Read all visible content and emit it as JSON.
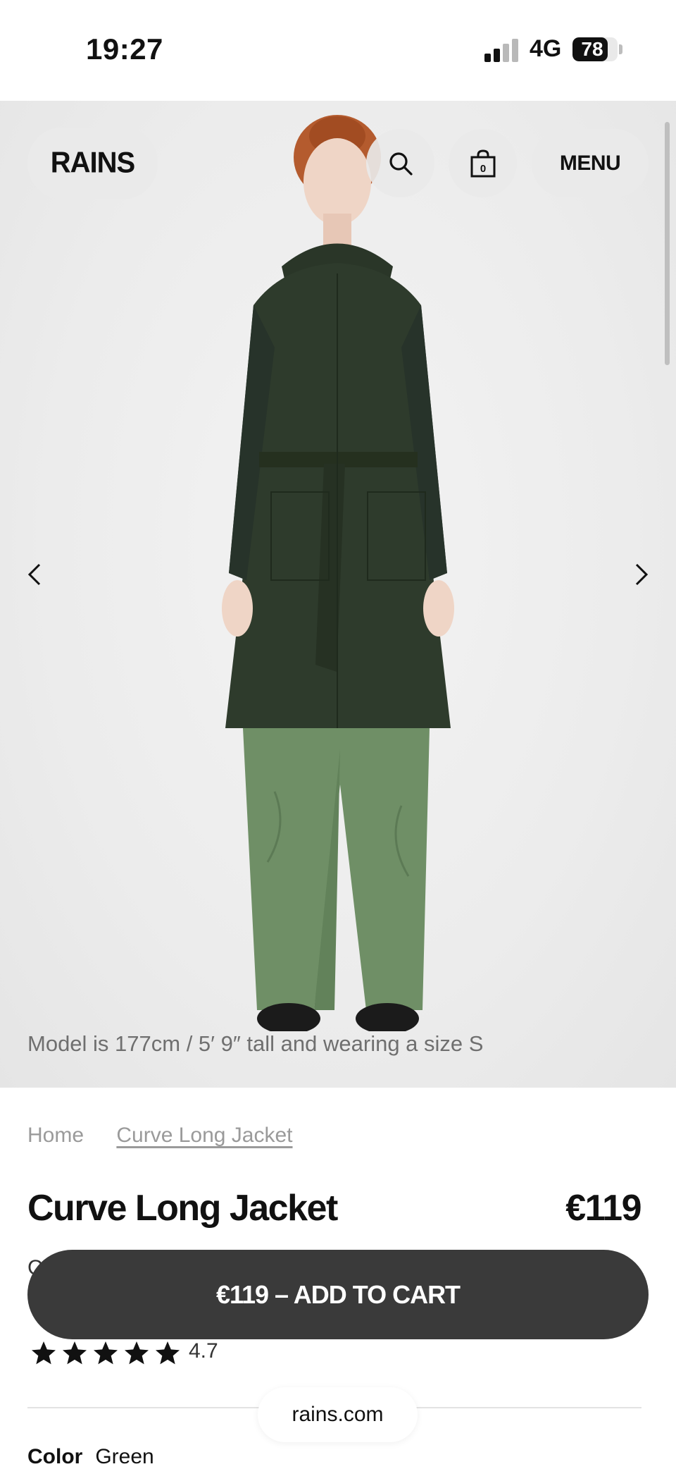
{
  "status_bar": {
    "time": "19:27",
    "network": "4G",
    "battery": "78",
    "battery_level": 0.78,
    "signal_bars": 2,
    "signal_total": 4
  },
  "header": {
    "logo": "RAINS",
    "menu_label": "MENU",
    "bag_count": "0",
    "search_icon": "search-icon",
    "bag_icon": "shopping-bag-icon"
  },
  "hero": {
    "caption": "Model is 177cm / 5′ 9″ tall and wearing a size S",
    "prev_icon": "chevron-left-icon",
    "next_icon": "chevron-right-icon",
    "colors": {
      "jacket": "#2e3b2c",
      "pants": "#6f8f66",
      "hair": "#b45b2e"
    }
  },
  "breadcrumb": {
    "home": "Home",
    "current": "Curve Long Jacket"
  },
  "product": {
    "title": "Curve Long Jacket",
    "price": "€119",
    "subtitle_partial": "C",
    "rating": "4.7",
    "rating_stars": 5,
    "color_label": "Color",
    "color_value": "Green"
  },
  "cart_button": {
    "label": "€119 – ADD TO CART"
  },
  "browser": {
    "domain": "rains.com"
  }
}
